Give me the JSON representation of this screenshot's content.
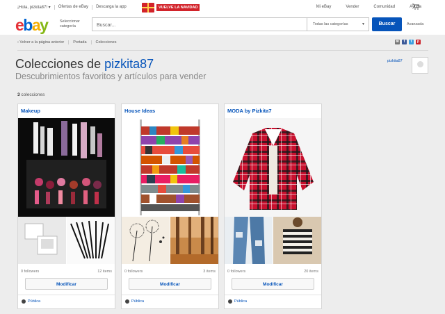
{
  "topbar": {
    "greeting": "¡Hola, pizkita87! ▾",
    "links": [
      "Ofertas de eBay",
      "Descarga la app"
    ],
    "promo": "VUELVE LA NAVIDAD",
    "right_links": [
      "Mi eBay",
      "Vender",
      "Comunidad",
      "Ayuda"
    ]
  },
  "header": {
    "logo": {
      "e": "e",
      "b": "b",
      "a": "a",
      "y": "y"
    },
    "select_category": "Seleccionar categoría",
    "search_placeholder": "Buscar...",
    "category_value": "Todas las categorías",
    "search_button": "Buscar",
    "advanced": "Avanzada"
  },
  "breadcrumb": [
    "‹ Volver a la página anterior",
    "Portada",
    "Colecciones"
  ],
  "page": {
    "title_prefix": "Colecciones de",
    "title_user": "pizkita87",
    "subtitle": "Descubrimientos favoritos y artículos para vender",
    "username": "pizkita87",
    "count_num": "3",
    "count_label": " colecciones"
  },
  "collections": [
    {
      "title": "Makeup",
      "followers": "0 followers",
      "items": "12 items",
      "button": "Modificar",
      "visibility": "Pública"
    },
    {
      "title": "House Ideas",
      "followers": "0 followers",
      "items": "3 items",
      "button": "Modificar",
      "visibility": "Pública"
    },
    {
      "title": "MODA by Pizkita7",
      "followers": "0 followers",
      "items": "20 items",
      "button": "Modificar",
      "visibility": "Pública"
    }
  ],
  "colors": {
    "brand_blue": "#0654ba",
    "logo_red": "#e53238",
    "logo_blue": "#0064d2",
    "logo_yellow": "#f5af02",
    "logo_green": "#86b817"
  },
  "icons": [
    "cart-icon",
    "email-share-icon",
    "facebook-share-icon",
    "twitter-share-icon",
    "pinterest-share-icon",
    "globe-icon",
    "gift-icon"
  ]
}
